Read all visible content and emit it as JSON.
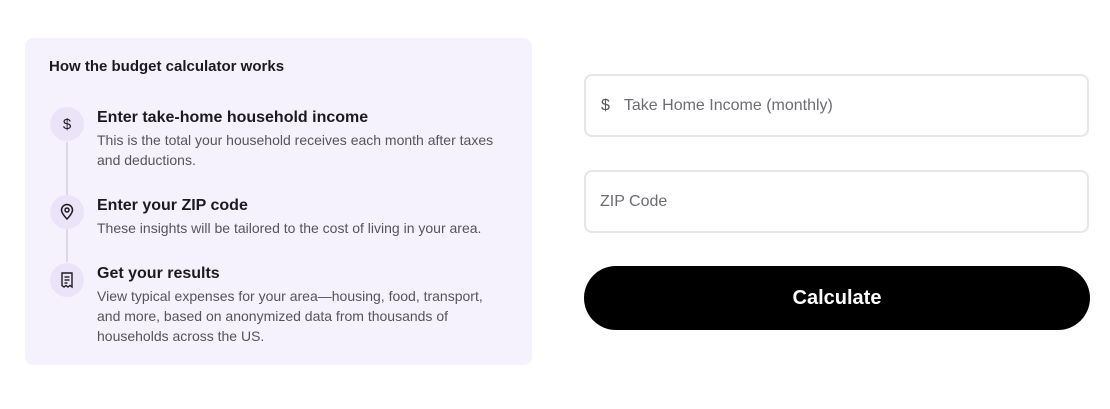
{
  "info": {
    "title": "How the budget calculator works",
    "steps": [
      {
        "icon": "dollar-icon",
        "title": "Enter take-home household income",
        "description": "This is the total your household receives each month after taxes and deductions."
      },
      {
        "icon": "location-pin-icon",
        "title": "Enter your ZIP code",
        "description": "These insights will be tailored to the cost of living in your area."
      },
      {
        "icon": "receipt-icon",
        "title": "Get your results",
        "description": "View typical expenses for your area—housing, food, transport, and more, based on anonymized data from thousands of households across the US."
      }
    ]
  },
  "form": {
    "income": {
      "prefix": "$",
      "placeholder": "Take Home Income (monthly)",
      "value": ""
    },
    "zip": {
      "placeholder": "ZIP Code",
      "value": ""
    },
    "submit_label": "Calculate"
  },
  "colors": {
    "card_background": "#f6f2fd",
    "icon_circle": "#ebe4f8",
    "button_background": "#000000",
    "button_text": "#ffffff",
    "field_border": "#e6e6e8"
  }
}
